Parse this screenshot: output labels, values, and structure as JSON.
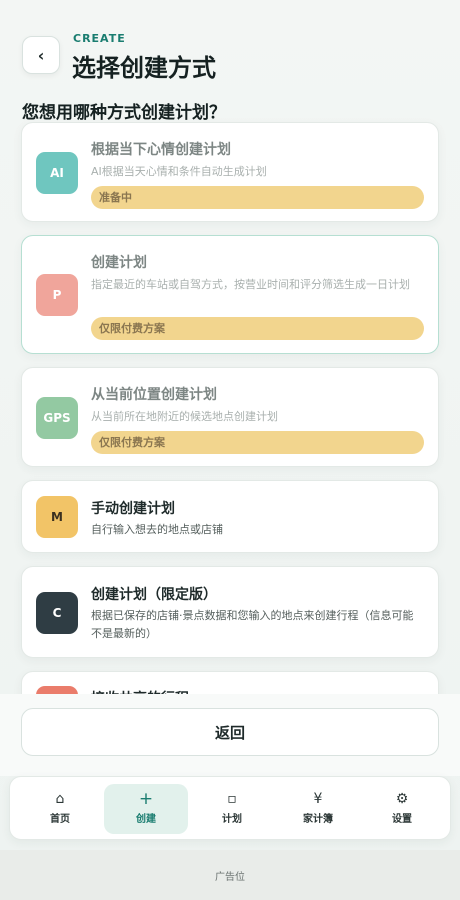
{
  "header": {
    "back_icon": "chevron-left-icon",
    "back_glyph": "‹",
    "eyebrow": "CREATE",
    "title": "选择创建方式"
  },
  "question": "您想用哪种方式创建计划？",
  "options": [
    {
      "icon_text": "AI",
      "icon_color": "#6fc6bf",
      "title": "根据当下心情创建计划",
      "desc": "AI根据当天心情和条件自动生成计划",
      "badge": "准备中",
      "state": "disabled"
    },
    {
      "icon_text": "P",
      "icon_color": "#f0a59b",
      "title": "创建计划",
      "desc": "指定最近的车站或自驾方式，按营业时间和评分筛选生成一日计划",
      "badge": "仅限付费方案",
      "state": "selected-locked"
    },
    {
      "icon_text": "GPS",
      "icon_color": "#93c9a2",
      "title": "从当前位置创建计划",
      "desc": "从当前所在地附近的候选地点创建计划",
      "badge": "仅限付费方案",
      "state": "locked"
    },
    {
      "icon_text": "M",
      "icon_color": "#f2c467",
      "title": "手动创建计划",
      "desc": "自行输入想去的地点或店铺",
      "state": "enabled"
    },
    {
      "icon_text": "C",
      "icon_color": "#2f3d44",
      "title": "创建计划（限定版）",
      "desc": "根据已保存的店铺·景点数据和您输入的地点来创建行程（信息可能不是最新的）",
      "state": "enabled"
    },
    {
      "icon_color": "#ea7c6b",
      "title": "接收共享的行程",
      "state": "enabled"
    }
  ],
  "return_label": "返回",
  "tabs": [
    {
      "label": "首页",
      "icon": "home-icon",
      "glyph": "⌂"
    },
    {
      "label": "创建",
      "icon": "plus-icon",
      "glyph": "+",
      "active": true
    },
    {
      "label": "计划",
      "icon": "square-icon",
      "glyph": "▫"
    },
    {
      "label": "家计簿",
      "icon": "yen-icon",
      "glyph": "¥"
    },
    {
      "label": "设置",
      "icon": "gear-icon",
      "glyph": "⚙"
    }
  ],
  "ad_label": "广告位",
  "colors": {
    "accent": "#1a7d70",
    "badge": "#f2d58e",
    "active_tab_bg": "#e2f1ec"
  }
}
